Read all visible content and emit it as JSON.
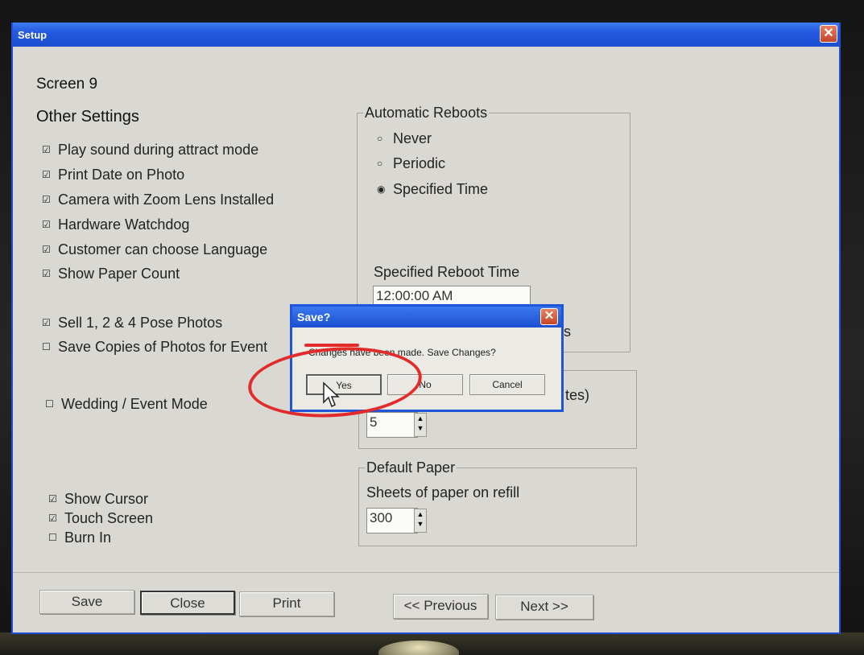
{
  "window": {
    "title": "Setup",
    "close_glyph": "✕"
  },
  "page": {
    "screen": "Screen 9",
    "section": "Other Settings"
  },
  "checkboxes_main": [
    {
      "label": "Play sound during attract mode",
      "checked": true
    },
    {
      "label": "Print Date on Photo",
      "checked": true
    },
    {
      "label": "Camera with Zoom Lens Installed",
      "checked": true
    },
    {
      "label": "Hardware Watchdog",
      "checked": true
    },
    {
      "label": "Customer can choose Language",
      "checked": true
    },
    {
      "label": "Show Paper Count",
      "checked": true
    }
  ],
  "checkboxes_pose": [
    {
      "label": "Sell 1, 2 & 4 Pose Photos",
      "checked": true
    },
    {
      "label": "Save Copies of Photos for Event",
      "checked": false
    }
  ],
  "wedding": {
    "label": "Wedding / Event Mode",
    "checked": false
  },
  "checkboxes_bottom": [
    {
      "label": "Show Cursor",
      "checked": true
    },
    {
      "label": "Touch Screen",
      "checked": true
    },
    {
      "label": "Burn In",
      "checked": false
    }
  ],
  "reboots": {
    "label": "Automatic Reboots",
    "options": [
      {
        "label": "Never",
        "selected": false
      },
      {
        "label": "Periodic",
        "selected": false
      },
      {
        "label": "Specified Time",
        "selected": true
      }
    ],
    "time_label": "Specified Reboot Time",
    "time_value": "12:00:00 AM",
    "partial_text": "s"
  },
  "interval": {
    "partial_label": "tes)",
    "value": "5"
  },
  "paper": {
    "label": "Default Paper",
    "sheets_label": "Sheets of paper on refill",
    "value": "300"
  },
  "spin": {
    "up": "▲",
    "down": "▼"
  },
  "footer": {
    "save": "Save",
    "close": "Close",
    "print": "Print",
    "previous": "<< Previous",
    "next": "Next >>"
  },
  "dialog": {
    "title": "Save?",
    "close_glyph": "✕",
    "message": "Changes have been made.  Save Changes?",
    "yes": "Yes",
    "no": "No",
    "cancel": "Cancel"
  },
  "glyphs": {
    "checked": "☑",
    "unchecked": "☐",
    "radio_on": "◉",
    "radio_off": "○"
  },
  "colors": {
    "titlebar": "#2459e0",
    "window_bg": "#d9d8d2",
    "annotation": "#e22b2b"
  }
}
